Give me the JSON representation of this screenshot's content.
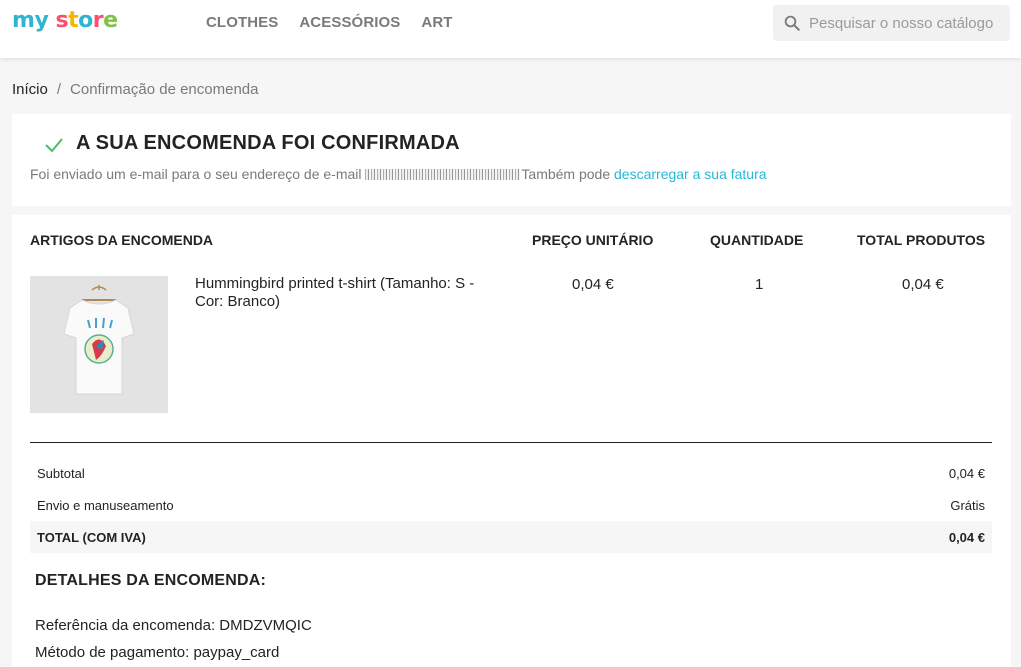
{
  "header": {
    "logo": {
      "letters": [
        "m",
        "y",
        " ",
        "s",
        "t",
        "o",
        "r",
        "e"
      ],
      "colors": [
        "#2fb5d2",
        "#2fb5d2",
        "#ffffff",
        "#ff4c70",
        "#f6b600",
        "#2fb5d2",
        "#ff4c70",
        "#7fc343"
      ]
    },
    "nav": [
      "CLOTHES",
      "ACESSÓRIOS",
      "ART"
    ],
    "search_placeholder": "Pesquisar o nosso catálogo"
  },
  "breadcrumb": {
    "home": "Início",
    "separator": "/",
    "current": "Confirmação de encomenda"
  },
  "confirmation": {
    "title": "A SUA ENCOMENDA FOI CONFIRMADA",
    "text_before": "Foi enviado um e-mail para o seu endereço de e-mail ",
    "text_after": "Também pode ",
    "link": "descarregar a sua fatura"
  },
  "order": {
    "columns": {
      "items": "ARTIGOS DA ENCOMENDA",
      "unit_price": "PREÇO UNITÁRIO",
      "quantity": "QUANTIDADE",
      "total": "TOTAL PRODUTOS"
    },
    "product": {
      "name": "Hummingbird printed t-shirt (Tamanho: S - Cor: Branco)",
      "unit_price": "0,04 €",
      "quantity": "1",
      "total": "0,04 €"
    },
    "summary": {
      "subtotal_label": "Subtotal",
      "subtotal_value": "0,04 €",
      "shipping_label": "Envio e manuseamento",
      "shipping_value": "Grátis",
      "total_label": "TOTAL (COM IVA)",
      "total_value": "0,04 €"
    },
    "details": {
      "title": "DETALHES DA ENCOMENDA:",
      "reference": "Referência da encomenda: DMDZVMQIC",
      "payment": "Método de pagamento: paypay_card"
    }
  },
  "colors": {
    "accent": "#24b9d7",
    "check": "#4cbb6c"
  }
}
